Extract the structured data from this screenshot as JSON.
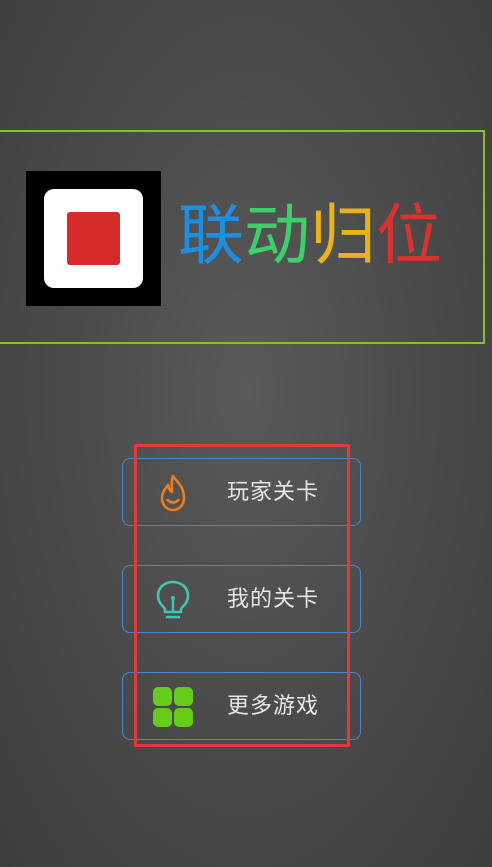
{
  "title": {
    "chars": [
      "联",
      "动",
      "归",
      "位"
    ],
    "char_colors": [
      "#1e8fe0",
      "#3ccf6a",
      "#e8b21c",
      "#d8332f"
    ]
  },
  "colors": {
    "banner_border": "#7fc22a",
    "button_border": "#4a86cf",
    "highlight_frame": "#e03a3a",
    "logo_red": "#d52b2b",
    "fire_icon": "#f07b1c",
    "bulb_icon": "#3fc7b0",
    "grid_icon": "#66cc1a"
  },
  "menu": {
    "items": [
      {
        "label": "玩家关卡",
        "icon": "fire-icon"
      },
      {
        "label": "我的关卡",
        "icon": "lightbulb-icon"
      },
      {
        "label": "更多游戏",
        "icon": "grid-icon"
      }
    ]
  }
}
